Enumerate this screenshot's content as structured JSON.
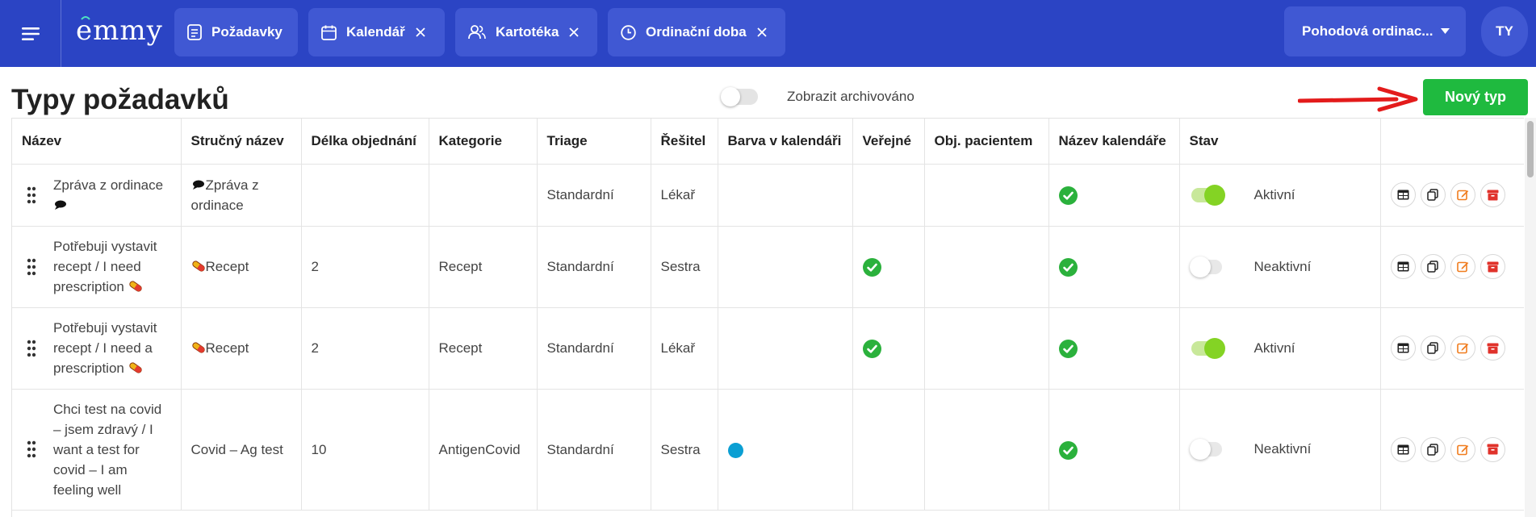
{
  "app": {
    "logo_text": "emmy"
  },
  "tabs": [
    {
      "label": "Požadavky",
      "icon": "document-icon",
      "closable": false
    },
    {
      "label": "Kalendář",
      "icon": "calendar-icon",
      "closable": true
    },
    {
      "label": "Kartotéka",
      "icon": "users-icon",
      "closable": true
    },
    {
      "label": "Ordinační doba",
      "icon": "clock-icon",
      "closable": true
    }
  ],
  "practice_select": {
    "value": "Pohodová ordinac..."
  },
  "user": {
    "initials": "TY"
  },
  "page": {
    "title": "Typy požadavků",
    "archive_label": "Zobrazit archivováno",
    "archive_on": false,
    "new_button": "Nový typ"
  },
  "colors": {
    "topbar": "#2b44c4",
    "tab": "#4058d3",
    "accent_green": "#1fba3f",
    "check_green": "#2bb13c",
    "toggle_on": "#84d324",
    "calendar_dot": "#0b9fd3",
    "edit_orange": "#f07c1e",
    "archive_red": "#e0322b"
  },
  "table": {
    "headers": {
      "name": "Název",
      "short": "Stručný název",
      "length": "Délka objednání",
      "category": "Kategorie",
      "triage": "Triage",
      "solver": "Řešitel",
      "color": "Barva v kalendáři",
      "public": "Veřejné",
      "patient": "Obj. pacientem",
      "calendar_name": "Název kalendáře",
      "status": "Stav"
    },
    "rows": [
      {
        "name": "Zpráva z ordinace",
        "name_emoji": "speech-bubble",
        "short": "Zpráva z ordinace",
        "short_emoji": "speech-bubble",
        "length": "",
        "category": "",
        "triage": "Standardní",
        "solver": "Lékař",
        "color": "",
        "public": false,
        "patient": false,
        "calendar_name": true,
        "active": true,
        "status": "Aktivní"
      },
      {
        "name": "Potřebuji vystavit recept / I need prescription",
        "name_emoji": "pill",
        "short": "Recept",
        "short_emoji": "pill",
        "length": "2",
        "category": "Recept",
        "triage": "Standardní",
        "solver": "Sestra",
        "color": "",
        "public": true,
        "patient": false,
        "calendar_name": true,
        "active": false,
        "status": "Neaktivní"
      },
      {
        "name": "Potřebuji vystavit recept / I need a prescription",
        "name_emoji": "pill",
        "short": "Recept",
        "short_emoji": "pill",
        "length": "2",
        "category": "Recept",
        "triage": "Standardní",
        "solver": "Lékař",
        "color": "",
        "public": true,
        "patient": false,
        "calendar_name": true,
        "active": true,
        "status": "Aktivní"
      },
      {
        "name": "Chci test na covid – jsem zdravý / I want a test for covid – I am feeling well",
        "name_emoji": "",
        "short": "Covid – Ag test",
        "short_emoji": "",
        "length": "10",
        "category": "AntigenCovid",
        "triage": "Standardní",
        "solver": "Sestra",
        "color": "#0b9fd3",
        "public": false,
        "patient": false,
        "calendar_name": true,
        "active": false,
        "status": "Neaktivní"
      }
    ],
    "row_actions": [
      "table-view-icon",
      "duplicate-icon",
      "edit-icon",
      "archive-icon"
    ]
  }
}
